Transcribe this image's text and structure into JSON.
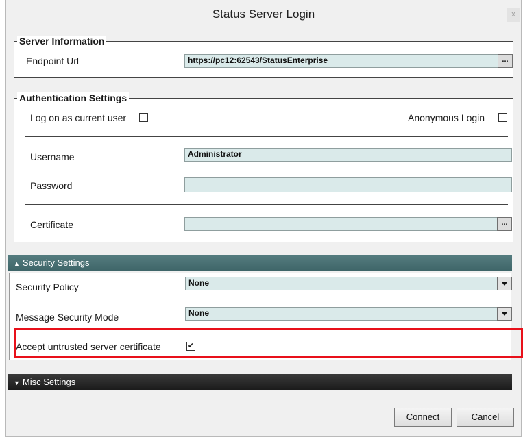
{
  "window": {
    "title": "Status Server Login",
    "close_label": "x"
  },
  "server_info": {
    "legend": "Server Information",
    "endpoint_label": "Endpoint Url",
    "endpoint_value": "https://pc12:62543/StatusEnterprise",
    "browse_label": "..."
  },
  "auth": {
    "legend": "Authentication Settings",
    "logon_current_label": "Log on as current user",
    "logon_current_checked": false,
    "anonymous_label": "Anonymous Login",
    "anonymous_checked": false,
    "username_label": "Username",
    "username_value": "Administrator",
    "password_label": "Password",
    "password_value": "",
    "certificate_label": "Certificate",
    "certificate_value": "",
    "browse_label": "..."
  },
  "security": {
    "header": "Security Settings",
    "header_icon": "chevron-up-icon",
    "policy_label": "Security Policy",
    "policy_value": "None",
    "mode_label": "Message Security Mode",
    "mode_value": "None",
    "accept_label": "Accept untrusted server certificate",
    "accept_checked": true
  },
  "misc": {
    "header": "Misc Settings",
    "header_icon": "chevron-down-icon"
  },
  "buttons": {
    "connect": "Connect",
    "cancel": "Cancel"
  },
  "colors": {
    "field_bg": "#daeaea",
    "security_header": "#4a7275",
    "misc_header": "#2a2a2a",
    "highlight": "#e8101a"
  }
}
